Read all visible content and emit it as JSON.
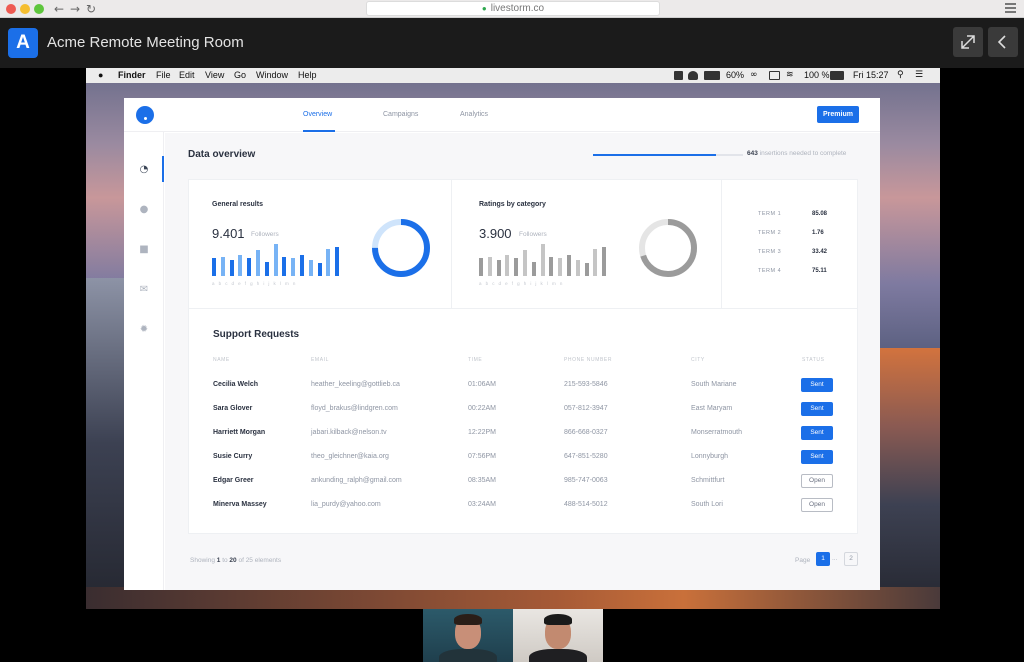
{
  "browser": {
    "url": "livestorm.co"
  },
  "app": {
    "logo_letter": "A",
    "title": "Acme Remote Meeting Room"
  },
  "menubar": {
    "items": [
      "Finder",
      "File",
      "Edit",
      "View",
      "Go",
      "Window",
      "Help"
    ],
    "battery": "60%",
    "battery2": "100 %",
    "clock": "Fri 15:27"
  },
  "nav": {
    "tabs": [
      "Overview",
      "Campaigns",
      "Analytics"
    ],
    "premium_label": "Premium"
  },
  "overview": {
    "title": "Data overview",
    "progress_fraction": 0.82,
    "progress_count": "643",
    "progress_suffix": "insertions needed to complete"
  },
  "general": {
    "label": "General results",
    "value": "9.401",
    "sub": "Followers",
    "bars": [
      0.55,
      0.6,
      0.5,
      0.65,
      0.55,
      0.8,
      0.45,
      1.0,
      0.6,
      0.55,
      0.65,
      0.5,
      0.4,
      0.85,
      0.9
    ],
    "letters": "abcdefghijklmn",
    "donut_fraction": 0.75
  },
  "ratings": {
    "label": "Ratings by category",
    "value": "3.900",
    "sub": "Followers",
    "bars": [
      0.55,
      0.6,
      0.5,
      0.65,
      0.55,
      0.8,
      0.45,
      1.0,
      0.6,
      0.55,
      0.65,
      0.5,
      0.4,
      0.85,
      0.9
    ],
    "letters": "abcdefghijklmn",
    "donut_fraction": 0.7
  },
  "terms": [
    {
      "label": "TERM 1",
      "value": "85.08"
    },
    {
      "label": "TERM 2",
      "value": "1.76"
    },
    {
      "label": "TERM 3",
      "value": "33.42"
    },
    {
      "label": "TERM 4",
      "value": "75.11"
    }
  ],
  "support": {
    "title": "Support Requests",
    "headers": [
      "NAME",
      "EMAIL",
      "TIME",
      "PHONE NUMBER",
      "CITY",
      "STATUS"
    ],
    "rows": [
      {
        "name": "Cecilia Welch",
        "email": "heather_keeling@gottlieb.ca",
        "time": "01:06AM",
        "phone": "215-593-5846",
        "city": "South Mariane",
        "status": "Sent"
      },
      {
        "name": "Sara Glover",
        "email": "floyd_brakus@lindgren.com",
        "time": "00:22AM",
        "phone": "057-812-3947",
        "city": "East Maryam",
        "status": "Sent"
      },
      {
        "name": "Harriett Morgan",
        "email": "jabari.kilback@nelson.tv",
        "time": "12:22PM",
        "phone": "866-668-0327",
        "city": "Monserratmouth",
        "status": "Sent"
      },
      {
        "name": "Susie Curry",
        "email": "theo_gleichner@kaia.org",
        "time": "07:56PM",
        "phone": "647-851-5280",
        "city": "Lonnyburgh",
        "status": "Sent"
      },
      {
        "name": "Edgar Greer",
        "email": "ankunding_ralph@gmail.com",
        "time": "08:35AM",
        "phone": "985-747-0063",
        "city": "Schmittfurt",
        "status": "Open"
      },
      {
        "name": "Minerva Massey",
        "email": "lia_purdy@yahoo.com",
        "time": "03:24AM",
        "phone": "488-514-5012",
        "city": "South Lori",
        "status": "Open"
      }
    ]
  },
  "footer": {
    "showing": "Showing",
    "from": "1",
    "to_word": "to",
    "to": "20",
    "of_text": "of 25 elements",
    "page_label": "Page",
    "page_current": "1",
    "page_dots": "...",
    "page_next": "2"
  },
  "colors": {
    "accent": "#1b6fe8",
    "gray_bar": "#9b9b9b",
    "light_blue": "#77b3f5"
  }
}
